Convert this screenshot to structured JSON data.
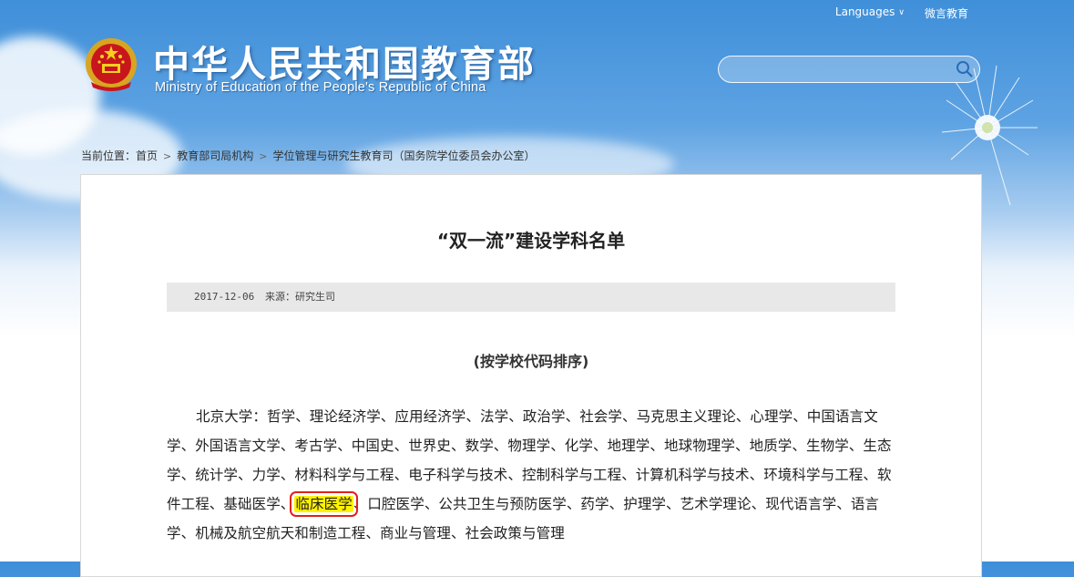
{
  "header": {
    "title": "中华人民共和国教育部",
    "subtitle": "Ministry of Education of the People's Republic of China",
    "languages_label": "Languages",
    "weiyan_label": "微言教育",
    "search_placeholder": ""
  },
  "breadcrumb": {
    "prefix": "当前位置：",
    "items": [
      "首页",
      "教育部司局机构",
      "学位管理与研究生教育司（国务院学位委员会办公室）"
    ]
  },
  "article": {
    "title": "“双一流”建设学科名单",
    "date": "2017-12-06",
    "source": "来源：研究生司",
    "subhead": "(按学校代码排序)",
    "body_before": "北京大学：哲学、理论经济学、应用经济学、法学、政治学、社会学、马克思主义理论、心理学、中国语言文学、外国语言文学、考古学、中国史、世界史、数学、物理学、化学、地理学、地球物理学、地质学、生物学、生态学、统计学、力学、材料科学与工程、电子科学与技术、控制科学与工程、计算机科学与技术、环境科学与工程、软件工程、基础医学、",
    "body_highlight": "临床医学",
    "body_after": "、口腔医学、公共卫生与预防医学、药学、护理学、艺术学理论、现代语言学、语言学、机械及航空航天和制造工程、商业与管理、社会政策与管理"
  },
  "colors": {
    "sky": "#3f8fd9",
    "highlight": "#fff200",
    "highlight_border": "#e0201a"
  }
}
